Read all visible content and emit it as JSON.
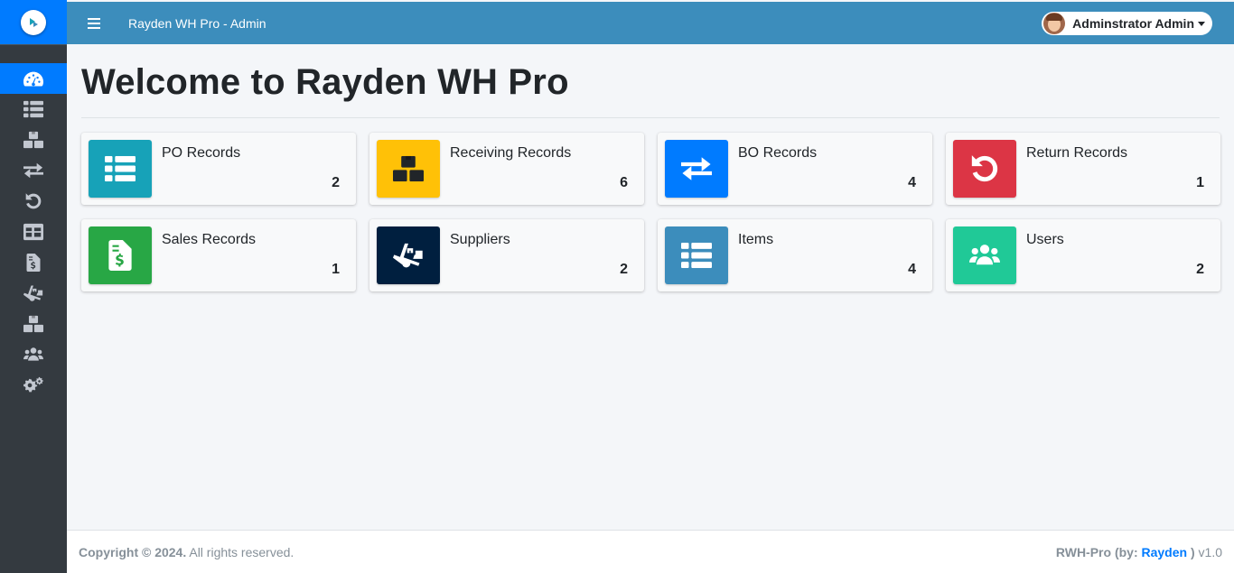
{
  "header": {
    "app_title": "Rayden WH Pro - Admin",
    "user_name": "Adminstrator Admin"
  },
  "page": {
    "title": "Welcome to Rayden WH Pro"
  },
  "cards": [
    {
      "label": "PO Records",
      "count": "2",
      "color": "#17a2b8",
      "icon": "list-icon"
    },
    {
      "label": "Receiving Records",
      "count": "6",
      "color": "#ffc107",
      "icon": "boxes-icon"
    },
    {
      "label": "BO Records",
      "count": "4",
      "color": "#007bff",
      "icon": "exchange-icon"
    },
    {
      "label": "Return Records",
      "count": "1",
      "color": "#dc3545",
      "icon": "undo-icon"
    },
    {
      "label": "Sales Records",
      "count": "1",
      "color": "#28a745",
      "icon": "invoice-dollar-icon"
    },
    {
      "label": "Suppliers",
      "count": "2",
      "color": "#001f3f",
      "icon": "dolly-icon"
    },
    {
      "label": "Items",
      "count": "4",
      "color": "#3c8dbc",
      "icon": "list-icon"
    },
    {
      "label": "Users",
      "count": "2",
      "color": "#20c997",
      "icon": "users-icon"
    }
  ],
  "sidebar": {
    "items": [
      {
        "icon": "dashboard-icon",
        "active": true
      },
      {
        "icon": "list-icon"
      },
      {
        "icon": "boxes-icon"
      },
      {
        "icon": "exchange-icon"
      },
      {
        "icon": "undo-icon"
      },
      {
        "icon": "table-icon"
      },
      {
        "icon": "invoice-dollar-icon"
      },
      {
        "icon": "dolly-icon"
      },
      {
        "icon": "boxes-icon"
      },
      {
        "icon": "users-icon"
      },
      {
        "icon": "cogs-icon"
      }
    ]
  },
  "footer": {
    "copyright_bold": "Copyright © 2024.",
    "copyright_rest": " All rights reserved.",
    "credit_prefix": "RWH-Pro (by: ",
    "credit_link": "Rayden",
    "credit_suffix": " )",
    "version": " v1.0"
  },
  "colors": {
    "topbar": "#3c8dbc",
    "sidebar": "#343a40",
    "accent": "#007bff"
  }
}
